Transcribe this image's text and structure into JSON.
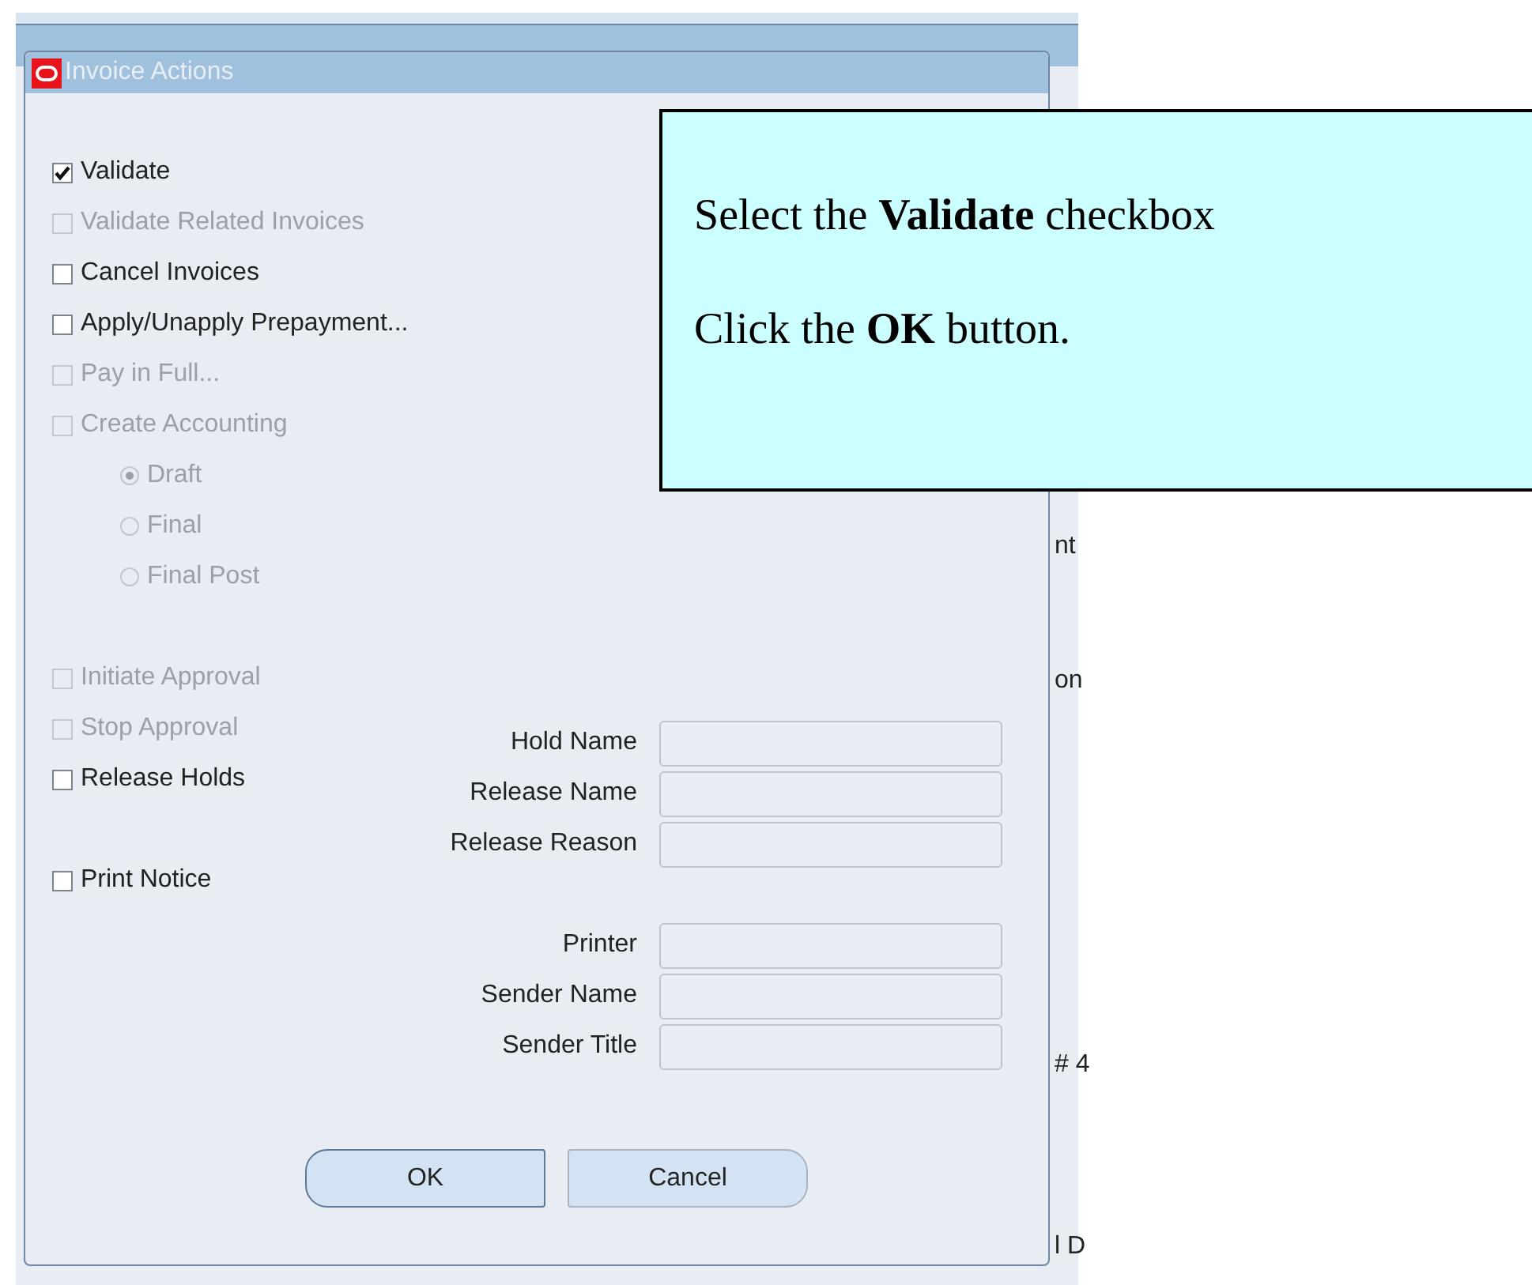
{
  "dialog": {
    "title": "Invoice Actions",
    "option_groups": [
      [
        {
          "kind": "checkbox",
          "label": "Validate",
          "checked": true,
          "disabled": false
        },
        {
          "kind": "checkbox",
          "label": "Validate Related Invoices",
          "checked": false,
          "disabled": true
        },
        {
          "kind": "checkbox",
          "label": "Cancel Invoices",
          "checked": false,
          "disabled": false
        },
        {
          "kind": "checkbox",
          "label": "Apply/Unapply Prepayment...",
          "checked": false,
          "disabled": false
        },
        {
          "kind": "checkbox",
          "label": "Pay in Full...",
          "checked": false,
          "disabled": true
        },
        {
          "kind": "checkbox",
          "label": "Create Accounting",
          "checked": false,
          "disabled": true
        },
        {
          "kind": "radio",
          "label": "Draft",
          "selected": true,
          "disabled": true
        },
        {
          "kind": "radio",
          "label": "Final",
          "selected": false,
          "disabled": true
        },
        {
          "kind": "radio",
          "label": "Final Post",
          "selected": false,
          "disabled": true
        }
      ],
      [
        {
          "kind": "checkbox",
          "label": "Initiate Approval",
          "checked": false,
          "disabled": true
        },
        {
          "kind": "checkbox",
          "label": "Stop Approval",
          "checked": false,
          "disabled": true
        },
        {
          "kind": "checkbox",
          "label": "Release Holds",
          "checked": false,
          "disabled": false
        }
      ],
      [
        {
          "kind": "checkbox",
          "label": "Print Notice",
          "checked": false,
          "disabled": false
        }
      ]
    ],
    "field_groups": [
      [
        {
          "label": "Hold Name"
        },
        {
          "label": "Release Name"
        },
        {
          "label": "Release Reason"
        }
      ],
      [
        {
          "label": "Printer"
        },
        {
          "label": "Sender Name"
        },
        {
          "label": "Sender Title"
        }
      ]
    ],
    "buttons": [
      {
        "label": "OK",
        "default": true
      },
      {
        "label": "Cancel",
        "default": false
      }
    ]
  },
  "background_fragments": [
    "nt",
    "on",
    "# 4",
    "l D"
  ],
  "callout": {
    "lines": [
      "Select the **Validate** checkbox",
      "Click the **OK** button."
    ]
  }
}
